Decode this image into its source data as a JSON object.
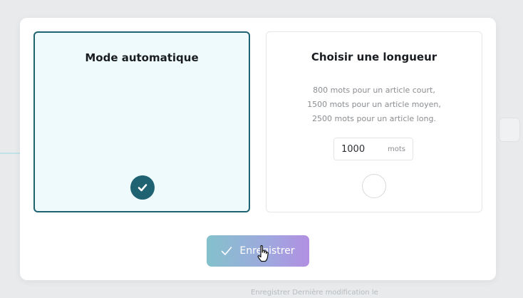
{
  "modal": {
    "options": [
      {
        "title": "Mode automatique",
        "selected": true
      },
      {
        "title": "Choisir une longueur",
        "description": [
          "800 mots pour un article court,",
          "1500 mots pour un article moyen,",
          "2500 mots pour un article long."
        ],
        "input_value": "1000",
        "input_unit": "mots",
        "selected": false
      }
    ],
    "save_label": "Enregistrer"
  },
  "background": {
    "ghost_text": "Enregistrer    Dernière modification le"
  },
  "colors": {
    "accent": "#1f6373",
    "selected_card_bg": "#eefafb",
    "button_gradient_start": "#84c1cc",
    "button_gradient_end": "#b18fe2"
  }
}
